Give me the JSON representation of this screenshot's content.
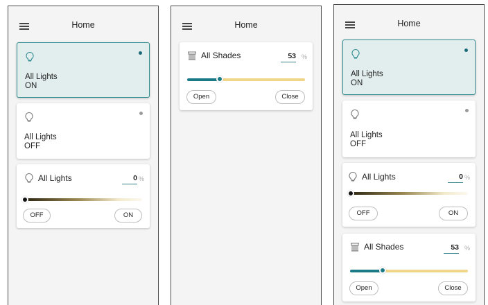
{
  "colors": {
    "accent": "#1a7a85",
    "dot_on": "#1a6a78",
    "dot_off": "#9a9a9a",
    "shade_track": "#f0d688"
  },
  "screens": [
    {
      "header": {
        "menu_icon": "hamburger-icon",
        "title": "Home"
      },
      "lights_on_card": {
        "icon": "lightbulb-icon",
        "line1": "All Lights",
        "line2": "ON"
      },
      "lights_off_card": {
        "icon": "lightbulb-icon",
        "line1": "All Lights",
        "line2": "OFF"
      },
      "dimmer": {
        "icon": "lightbulb-icon",
        "title": "All Lights",
        "value": "0",
        "unit": "%",
        "level": 0,
        "off_label": "OFF",
        "on_label": "ON"
      }
    },
    {
      "header": {
        "menu_icon": "hamburger-icon",
        "title": "Home"
      },
      "shades": {
        "icon": "shades-icon",
        "title": "All Shades",
        "value": "53",
        "unit": "%",
        "level": 0.27,
        "open_label": "Open",
        "close_label": "Close"
      }
    },
    {
      "header": {
        "menu_icon": "hamburger-icon",
        "title": "Home"
      },
      "lights_on_card": {
        "icon": "lightbulb-icon",
        "line1": "All Lights",
        "line2": "ON"
      },
      "lights_off_card": {
        "icon": "lightbulb-icon",
        "line1": "All Lights",
        "line2": "OFF"
      },
      "dimmer": {
        "icon": "lightbulb-icon",
        "title": "All Lights",
        "value": "0",
        "unit": "%",
        "level": 0,
        "off_label": "OFF",
        "on_label": "ON"
      },
      "shades": {
        "icon": "shades-icon",
        "title": "All Shades",
        "value": "53",
        "unit": "%",
        "level": 0.27,
        "open_label": "Open",
        "close_label": "Close"
      }
    }
  ]
}
